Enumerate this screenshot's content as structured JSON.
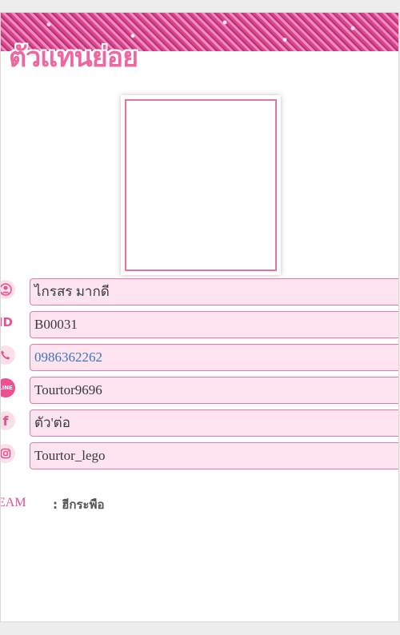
{
  "header": {
    "title": "ตัวแทนย่อย"
  },
  "profile": {
    "name": "ไกรสร  มากดี",
    "member_id": "B00031",
    "phone": "0986362262",
    "line": "Tourtor9696",
    "facebook": "ตัว'ต่อ",
    "instagram": "Tourtor_lego"
  },
  "team": {
    "label": "EAM",
    "value": ": ฮีกระพือ"
  },
  "icons": {
    "name": "user-icon",
    "member_id": "id-icon",
    "phone": "phone-icon",
    "line": "line-icon",
    "facebook": "facebook-icon",
    "instagram": "instagram-icon"
  },
  "colors": {
    "accent": "#ee4f8f",
    "field_bg": "#fde4ef",
    "field_border": "#e27aa6",
    "link": "#3f75c4"
  }
}
